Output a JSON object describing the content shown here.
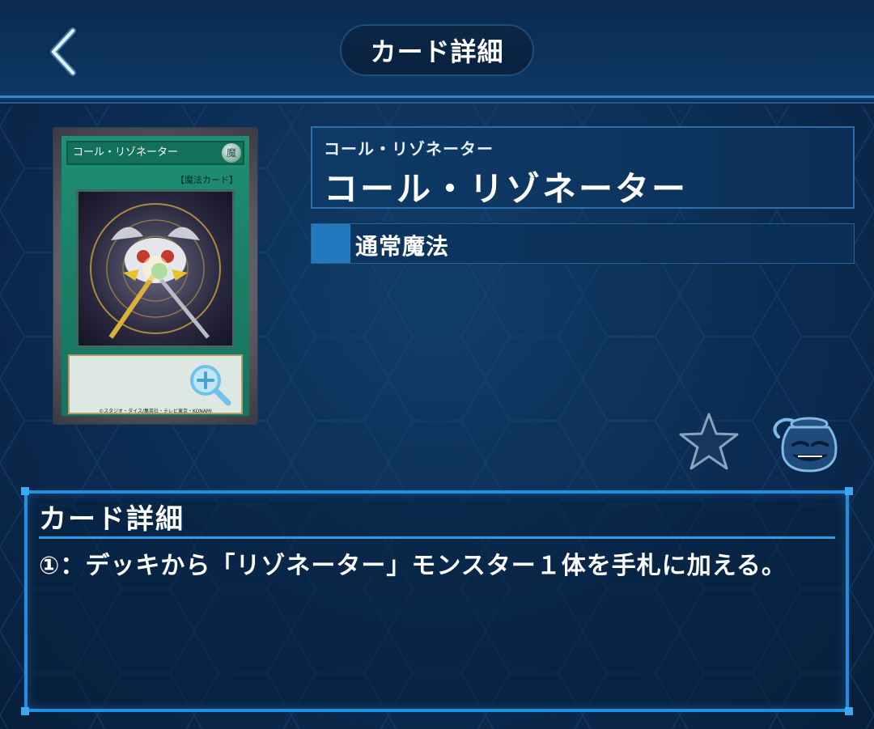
{
  "header": {
    "title": "カード詳細",
    "back_icon": "chevron-left-icon"
  },
  "card": {
    "name_small": "コール・リゾネーター",
    "name_large": "コール・リゾネーター",
    "type": "通常魔法",
    "image": {
      "name_bar": "コール・リゾネーター",
      "attribute": "魔",
      "type_line": "【魔法カード】",
      "copyright": "©スタジオ・ダイス/集英社・テレビ東京・KONAMI"
    }
  },
  "actions": {
    "favorite_icon": "star-icon",
    "zoom_icon": "magnifier-plus-icon",
    "pot_icon": "pot-of-greed-icon"
  },
  "details": {
    "heading": "カード詳細",
    "text": "①：デッキから「リゾネーター」モンスター１体を手札に加える。"
  },
  "colors": {
    "accent": "#1f8fe0",
    "panel": "#0d3560",
    "type_marker": "#2279bd",
    "card_green": "#1f8f73"
  }
}
